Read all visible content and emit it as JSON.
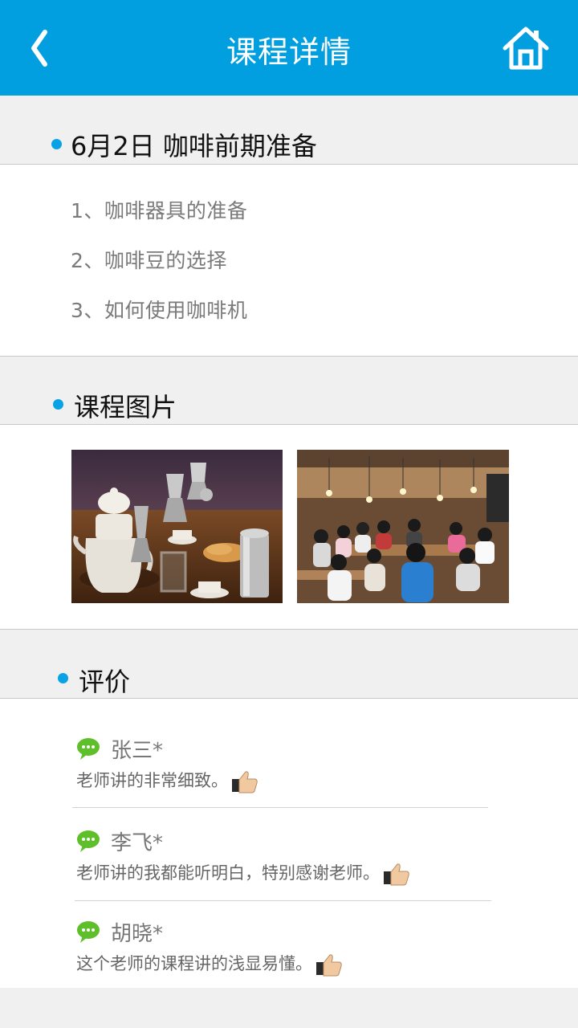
{
  "header": {
    "title": "课程详情",
    "back_icon": "chevron-left-icon",
    "home_icon": "home-icon",
    "bg_color": "#019fe0"
  },
  "schedule": {
    "heading": "6月2日  咖啡前期准备",
    "items": [
      "1、咖啡器具的准备",
      "2、咖啡豆的选择",
      "3、如何使用咖啡机"
    ]
  },
  "photos": {
    "heading": "课程图片",
    "items": [
      {
        "subject": "咖啡器具"
      },
      {
        "subject": "课堂现场"
      }
    ]
  },
  "reviews": {
    "heading": "评价",
    "items": [
      {
        "name": "张三*",
        "comment": "老师讲的非常细致。",
        "icon": "chat-bubble-icon",
        "badge": "thumbs-up-icon"
      },
      {
        "name": "李飞*",
        "comment": "老师讲的我都能听明白，特别感谢老师。",
        "icon": "chat-bubble-icon",
        "badge": "thumbs-up-icon"
      },
      {
        "name": "胡晓*",
        "comment": "这个老师的课程讲的浅显易懂。",
        "icon": "chat-bubble-icon",
        "badge": "thumbs-up-icon"
      }
    ]
  },
  "colors": {
    "accent_dot": "#09a2e6",
    "bubble_green": "#5fbf2a"
  }
}
